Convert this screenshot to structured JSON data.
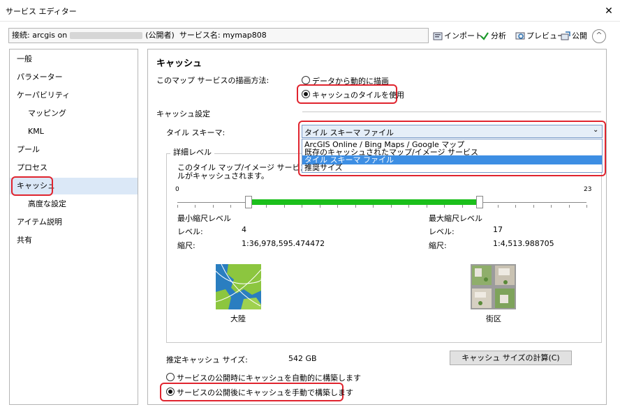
{
  "window": {
    "title": "サービス エディター",
    "close_glyph": "✕"
  },
  "connection": {
    "prefix": "接続: arcgis on",
    "publisher": "(公開者)",
    "service_label": "サービス名: mymap808"
  },
  "toolbar": {
    "import": "インポート",
    "analyze": "分析",
    "preview": "プレビュー",
    "publish": "公開",
    "collapse_glyph": "^"
  },
  "nav": {
    "items": [
      {
        "label": "一般"
      },
      {
        "label": "パラメーター"
      },
      {
        "label": "ケーパビリティ"
      },
      {
        "label": "マッピング"
      },
      {
        "label": "KML"
      },
      {
        "label": "プール"
      },
      {
        "label": "プロセス"
      },
      {
        "label": "キャッシュ"
      },
      {
        "label": "高度な設定"
      },
      {
        "label": "アイテム説明"
      },
      {
        "label": "共有"
      }
    ],
    "selected": "キャッシュ"
  },
  "cache": {
    "heading": "キャッシュ",
    "draw_method_label": "このマップ サービスの描画方法:",
    "draw_options": [
      {
        "label": "データから動的に描画",
        "selected": false
      },
      {
        "label": "キャッシュのタイルを使用",
        "selected": true
      }
    ],
    "settings_label": "キャッシュ設定",
    "tile_scheme_label": "タイル スキーマ:",
    "tile_scheme_value": "タイル スキーマ ファイル",
    "tile_scheme_options": [
      {
        "label": "ArcGIS Online / Bing Maps / Google マップ",
        "highlighted": false
      },
      {
        "label": "既存のキャッシュされたマップ/イメージ サービス",
        "highlighted": false
      },
      {
        "label": "タイル スキーマ ファイル",
        "highlighted": true
      },
      {
        "label": "推奨サイズ",
        "highlighted": false
      }
    ],
    "detail_group_label": "詳細レベル",
    "detail_desc_line1": "このタイル マップ/イメージ サービスの最",
    "detail_desc_line2": "ルがキャッシュされます。",
    "slider": {
      "min": 0,
      "max": 23,
      "low": 4,
      "high": 17
    },
    "min_scale": {
      "heading": "最小縮尺レベル",
      "level_label": "レベル:",
      "level_value": "4",
      "scale_label": "縮尺:",
      "scale_value": "1:36,978,595.474472",
      "image_caption": "大陸"
    },
    "max_scale": {
      "heading": "最大縮尺レベル",
      "level_label": "レベル:",
      "level_value": "17",
      "scale_label": "縮尺:",
      "scale_value": "1:4,513.988705",
      "image_caption": "街区"
    },
    "estimated_size_label": "推定キャッシュ サイズ:",
    "estimated_size_value": "542 GB",
    "calc_button": "キャッシュ サイズの計算(C)",
    "build_options": [
      {
        "label": "サービスの公開時にキャッシュを自動的に構築します",
        "selected": false
      },
      {
        "label": "サービスの公開後にキャッシュを手動で構築します",
        "selected": true
      }
    ]
  },
  "colors": {
    "highlight_red": "#e0242e",
    "slider_green": "#1bbf1b",
    "selection_blue": "#3d8ee3"
  }
}
